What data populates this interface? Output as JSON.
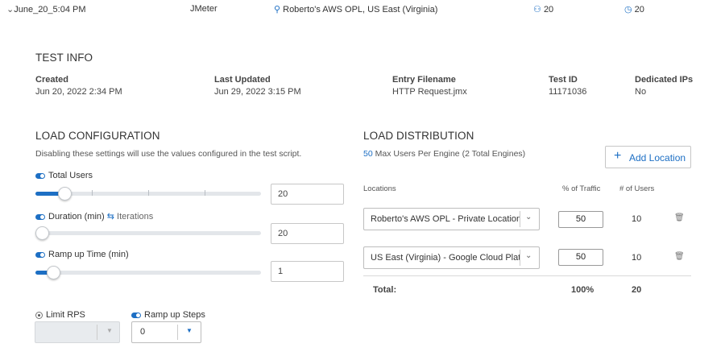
{
  "run_row": {
    "name": "June_20_5:04 PM",
    "tool": "JMeter",
    "location": "Roberto's AWS OPL, US East (Virginia)",
    "users": "20",
    "duration": "20"
  },
  "test_info": {
    "title": "TEST INFO",
    "created_label": "Created",
    "created_value": "Jun 20, 2022 2:34 PM",
    "updated_label": "Last Updated",
    "updated_value": "Jun 29, 2022 3:15 PM",
    "filename_label": "Entry Filename",
    "filename_value": "HTTP Request.jmx",
    "testid_label": "Test ID",
    "testid_value": "11171036",
    "ips_label": "Dedicated IPs",
    "ips_value": "No"
  },
  "load_config": {
    "title": "LOAD CONFIGURATION",
    "description": "Disabling these settings will use the values configured in the test script.",
    "total_users_label": "Total Users",
    "total_users_value": "20",
    "total_users_level": 0.1,
    "duration_label": "Duration (min)",
    "iterations_label": "Iterations",
    "duration_value": "20",
    "duration_level": 0,
    "ramp_label": "Ramp up Time (min)",
    "ramp_value": "1",
    "ramp_level": 0.05,
    "limit_rps_label": "Limit RPS",
    "ramp_steps_label": "Ramp up Steps",
    "ramp_steps_value": "0"
  },
  "load_distribution": {
    "title": "LOAD DISTRIBUTION",
    "max_users_number": "50",
    "max_users_text": "Max Users Per Engine (2 Total Engines)",
    "add_location_label": "Add Location",
    "col_locations": "Locations",
    "col_traffic": "% of Traffic",
    "col_users": "# of Users",
    "rows": [
      {
        "location": "Roberto's AWS OPL - Private Locations",
        "traffic": "50",
        "users": "10"
      },
      {
        "location": "US East (Virginia) - Google Cloud Plat...",
        "traffic": "50",
        "users": "10"
      }
    ],
    "total_label": "Total:",
    "total_traffic": "100%",
    "total_users": "20"
  },
  "colors": {
    "accent": "#1d6fc4",
    "text": "#333333",
    "track": "#e3e6ea"
  }
}
